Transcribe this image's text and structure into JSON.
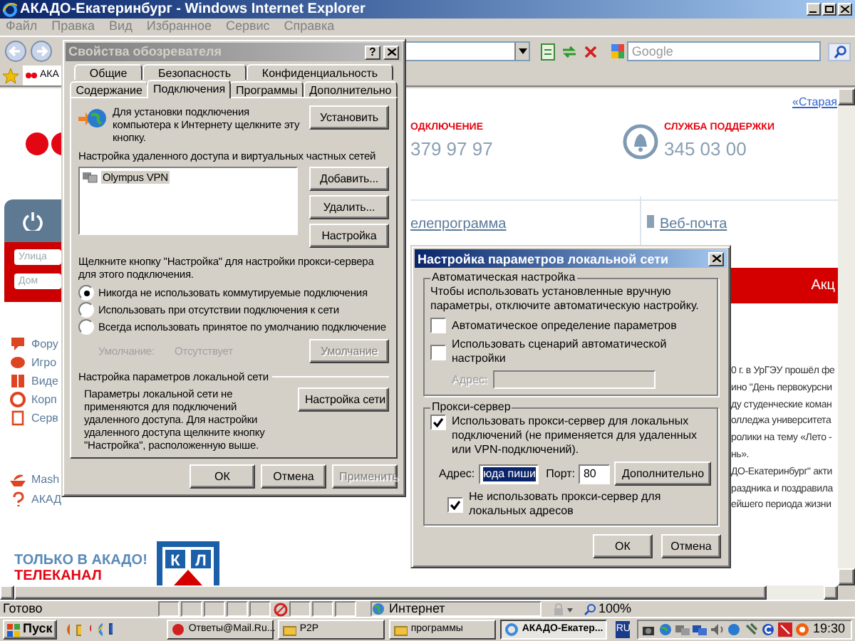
{
  "browser": {
    "title": "АКАДО-Екатеринбург - Windows Internet Explorer",
    "menu": [
      "Файл",
      "Правка",
      "Вид",
      "Избранное",
      "Сервис",
      "Справка"
    ],
    "search": {
      "placeholder": "Google"
    },
    "tab": {
      "label": "АКА"
    },
    "status_bar": {
      "text": "Готово",
      "zone": "Интернет",
      "zoom": "100%"
    }
  },
  "page": {
    "old_version_link": "«Старая",
    "connect": {
      "label": "ОДКЛЮЧЕНИЕ",
      "phone": "379 97 97"
    },
    "support": {
      "label": "СЛУЖБА ПОДДЕРЖКИ",
      "phone": "345 03 00"
    },
    "tv_link": "елепрограмма",
    "mail_link": "Веб-почта",
    "street_field": {
      "placeholder": "Улица"
    },
    "house_field": {
      "placeholder": "Дом"
    },
    "red_tab": "Акц",
    "menu": [
      "Фору",
      "Игро",
      "Виде",
      "Корп",
      "Серв"
    ],
    "menu_2": [
      "Mash",
      "АКАД"
    ],
    "banner": [
      "ТОЛЬКО В АКАДО!",
      "ТЕЛЕКАНАЛ"
    ],
    "logo_letters": [
      "К",
      "Л"
    ],
    "news_lines": [
      "0 г. в УрГЭУ прошёл фе",
      "ино \"День первокурсни",
      "ду студенческие коман",
      "олледжа университета",
      "ролики на тему «Лето -",
      "нь».",
      "ДО-Екатеринбург\" акти",
      "раздника и поздравила",
      "ейшего периода жизни"
    ]
  },
  "internet_options": {
    "title": "Свойства обозревателя",
    "help_button": "?",
    "tabs_back": [
      {
        "label": "Общие",
        "selected": false
      },
      {
        "label": "Безопасность",
        "selected": false
      },
      {
        "label": "Конфиденциальность",
        "selected": false
      }
    ],
    "tabs_front": [
      {
        "label": "Содержание",
        "selected": false
      },
      {
        "label": "Подключения",
        "selected": true
      },
      {
        "label": "Программы",
        "selected": false
      },
      {
        "label": "Дополнительно",
        "selected": false
      }
    ],
    "setup": {
      "text": "Для установки подключения компьютера к Интернету щелкните эту кнопку.",
      "button": "Установить"
    },
    "dialup": {
      "heading": "Настройка удаленного доступа и виртуальных частных сетей",
      "connections": [
        {
          "label": "Olympus VPN",
          "selected": true
        }
      ],
      "buttons": [
        "Добавить...",
        "Удалить...",
        "Настройка"
      ],
      "hint": "Щелкните кнопку \"Настройка\" для настройки прокси-сервера для этого подключения.",
      "options": [
        {
          "label": "Никогда не использовать коммутируемые подключения",
          "selected": true
        },
        {
          "label": "Использовать при отсутствии подключения к сети",
          "selected": false
        },
        {
          "label": "Всегда использовать принятое по умолчанию подключение",
          "selected": false
        }
      ],
      "default": {
        "label": "Умолчание:",
        "value": "Отсутствует",
        "button": "Умолчание",
        "disabled": true
      }
    },
    "lan": {
      "heading": "Настройка параметров локальной сети",
      "text": "Параметры локальной сети не применяются для подключений удаленного доступа. Для настройки удаленного доступа щелкните кнопку \"Настройка\", расположенную выше.",
      "button": "Настройка сети"
    },
    "buttons": [
      {
        "label": "ОК",
        "disabled": false
      },
      {
        "label": "Отмена",
        "disabled": false
      },
      {
        "label": "Применить",
        "disabled": true
      }
    ]
  },
  "lan_settings": {
    "title": "Настройка параметров локальной сети",
    "auto": {
      "heading": "Автоматическая настройка",
      "text": "Чтобы использовать установленные вручную параметры, отключите автоматическую настройку.",
      "options": [
        {
          "label": "Автоматическое определение параметров",
          "checked": false
        },
        {
          "label": "Использовать сценарий автоматической настройки",
          "checked": false
        }
      ],
      "address_label": "Адрес:",
      "address_disabled": true
    },
    "proxy": {
      "heading": "Прокси-сервер",
      "use_proxy": {
        "label": "Использовать прокси-сервер для локальных подключений (не применяется для удаленных или VPN-подключений).",
        "checked": true
      },
      "address_label": "Адрес:",
      "address": "юда пиши",
      "port_label": "Порт:",
      "port": "80",
      "advanced_button": "Дополнительно",
      "bypass_local": {
        "label": "Не использовать прокси-сервер для локальных адресов",
        "checked": true
      }
    },
    "buttons": [
      "ОК",
      "Отмена"
    ]
  },
  "taskbar": {
    "start": "Пуск",
    "tasks": [
      {
        "label": "Ответы@Mail.Ru...",
        "selected": false
      },
      {
        "label": "P2P",
        "selected": false
      },
      {
        "label": "программы",
        "selected": false
      },
      {
        "label": "АКАДО-Екатер...",
        "selected": true
      }
    ],
    "language": "RU",
    "clock": "19:30"
  }
}
